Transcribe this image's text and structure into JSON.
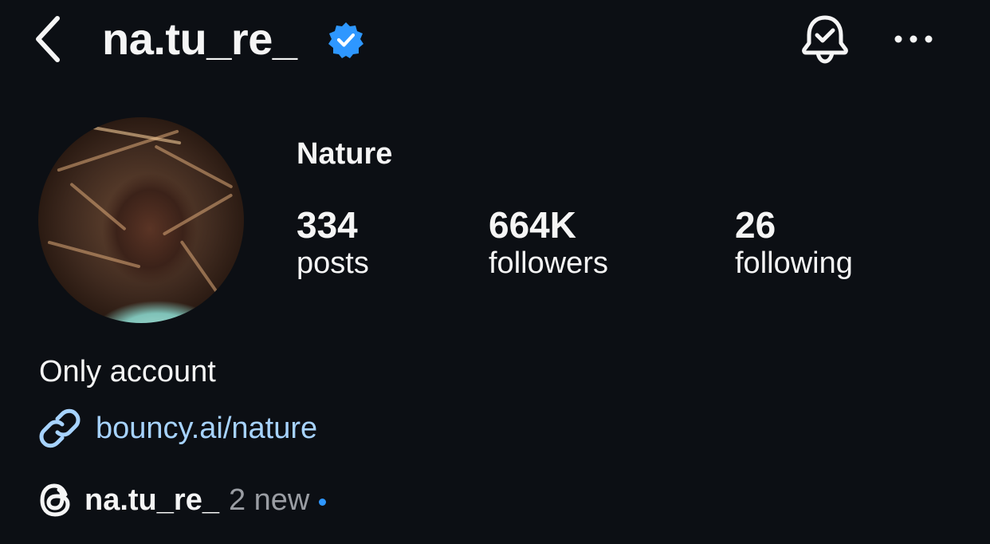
{
  "header": {
    "username": "na.tu_re_",
    "verified": true,
    "icons": {
      "back": "chevron-left-icon",
      "verified": "verified-badge-icon",
      "notifications": "bell-check-icon",
      "more": "more-horizontal-icon"
    }
  },
  "profile": {
    "display_name": "Nature",
    "stats": {
      "posts": {
        "value": "334",
        "label": "posts"
      },
      "followers": {
        "value": "664K",
        "label": "followers"
      },
      "following": {
        "value": "26",
        "label": "following"
      }
    },
    "bio": "Only account",
    "link": {
      "icon": "link-icon",
      "text": "bouncy.ai/nature"
    },
    "threads": {
      "icon": "threads-icon",
      "handle": "na.tu_re_",
      "new_text": "2 new"
    }
  },
  "colors": {
    "background": "#0c0f14",
    "text": "#f5f5f5",
    "link": "#a7d3ff",
    "verified": "#2e97ff",
    "muted": "#9a9da3"
  }
}
